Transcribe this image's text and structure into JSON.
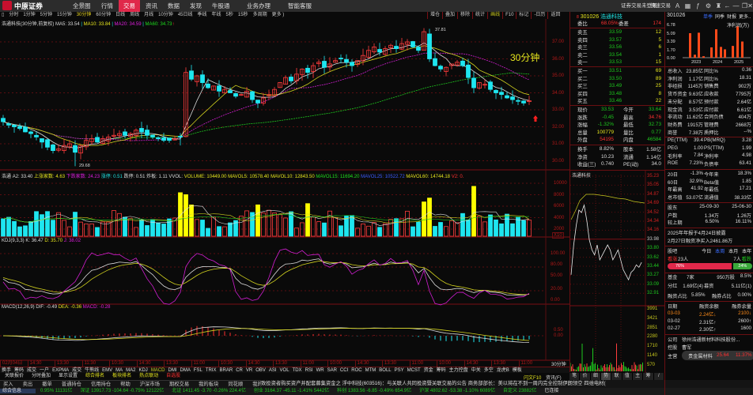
{
  "app": {
    "logo": "中原证券",
    "nav": [
      "全景图",
      "行情",
      "交易",
      "资讯",
      "数据",
      "发现",
      "牛股通",
      "业务办理",
      "智能客服"
    ],
    "active_nav": "交易",
    "login": "证券交易未登录",
    "quick_trade": "快速交易"
  },
  "periods": [
    "▯",
    "分时",
    "1分钟",
    "5分钟",
    "15分钟",
    "30分钟",
    "60分钟",
    "日线",
    "周线",
    "月线",
    "10分钟",
    "45日线",
    "季线",
    "年线",
    "5秒",
    "15秒",
    "多周期",
    "更多 )"
  ],
  "active_period": "30分钟",
  "toolbar2": [
    "增仓",
    "叠加",
    "移除",
    "统计",
    "画线",
    "F10",
    "标记",
    "-日历",
    "返回"
  ],
  "main": {
    "title": "浩通科技(30分钟,前复权)",
    "ma5": "MA5: 33.54",
    "ma10": "MA10: 33.84",
    "ma20": "MA20: 34.59",
    "ma60": "MA60: 34.73",
    "period_label": "30分钟",
    "high_label": "37.81",
    "low_label": "29.68",
    "price_axis": [
      "37.00",
      "36.00",
      "35.00",
      "34.00",
      "33.00",
      "32.00",
      "31.00",
      "30.00"
    ]
  },
  "chart_data": {
    "type": "candlestick",
    "closes": [
      32.3,
      32.1,
      32.0,
      31.9,
      31.7,
      31.6,
      31.4,
      31.1,
      30.8,
      30.6,
      30.7,
      30.9,
      31.0,
      30.5,
      30.9,
      31.2,
      31.3,
      31.1,
      31.3,
      31.4,
      31.5,
      31.6,
      31.5,
      31.6,
      31.8,
      31.7,
      31.5,
      31.4,
      31.3,
      31.2,
      31.2,
      31.3,
      31.4,
      35.2,
      34.8,
      35.0,
      34.6,
      34.3,
      34.4,
      34.1,
      34.2,
      34.0,
      33.8,
      33.9,
      34.1,
      33.6,
      33.4,
      33.7,
      33.9,
      34.2,
      34.6,
      34.9,
      34.7,
      35.1,
      35.4,
      35.2,
      35.6,
      35.8,
      35.5,
      35.7,
      35.9,
      36.0,
      35.8,
      35.6,
      35.9,
      36.2,
      36.5,
      36.7,
      36.4,
      36.6,
      36.8,
      36.6,
      36.9,
      37.0,
      36.7,
      36.5,
      37.6,
      36.0,
      35.6,
      35.4,
      35.5,
      35.7,
      35.8,
      35.6,
      34.9,
      34.3,
      34.6,
      34.5,
      34.2,
      34.0,
      33.9,
      33.7,
      33.6,
      33.5,
      33.4,
      33.53
    ],
    "ylim": [
      29.5,
      38
    ]
  },
  "vol": {
    "title": "浩通",
    "a2": "A2: 33.40",
    "l1": "上涨家数: 4.63",
    "l2": "下跌家数: 24.23",
    "l3": "涨停: 0.51",
    "l4": "跌停: 0.51",
    "l5": "炸板: 1.11",
    "vvol": "VVOL:",
    "volume": "VOLUME: 10449.00",
    "mavol5": "MAVOL5: 10578.40",
    "mavol10": "MAVOL10: 12843.50",
    "mavol15": "MAVOL15: 11694.20",
    "mavol25": "MAVOL25: 10522.72",
    "mavol60": "MAVOL60: 14744.18",
    "v2": "V2: 0.",
    "axis": [
      "10000",
      "8000",
      "6000",
      "4000",
      "2000"
    ],
    "unit": "X10"
  },
  "kdj": {
    "title": "KDJ(9,3,3)",
    "k": "K: 36.47",
    "d": "D: 35.70",
    "j": "J: 38.02",
    "axis": [
      "100.00",
      "80.00",
      "50.00",
      "20.00",
      "0.00"
    ]
  },
  "macd": {
    "title": "MACD(12,26,9)",
    "dif": "DIF: -0.49",
    "dea": "DEA: -0.36",
    "macd": "MACD: -0.28",
    "axis": [
      "0.50",
      "0.00"
    ]
  },
  "time_axis": [
    "02月04日",
    "14:30",
    "13:30",
    "11:30",
    "10:30",
    "14:30",
    "13:30",
    "11:00",
    "10:30",
    "14:30",
    "13:30",
    "11:00",
    "10:00",
    "14:30",
    "13:30",
    "11:00",
    "10:00",
    "14:30",
    "13:30",
    "11:00"
  ],
  "corner_label": "30分钟",
  "indicator_tabs": [
    "换手",
    "筹码",
    "成交",
    "一户",
    "EXPMA",
    "成交",
    "牛熊线",
    "EMV",
    "MA",
    "MA2",
    "KDJ",
    "MACD",
    "DMI",
    "DMA",
    "FSL",
    "TRIX",
    "BRAR",
    "CR",
    "VR",
    "OBV",
    "ASI",
    "VOL",
    "TDX",
    "RSI",
    "WR",
    "SAR",
    "CCI",
    "ROC",
    "MTM",
    "BOLL",
    "PSY",
    "MCST",
    "资金",
    "筹码",
    "主力控盘",
    "中关",
    "多空",
    "龙虎B",
    "模板"
  ],
  "active_indicator": "MACD",
  "bottom_links": [
    {
      "t": "关联报价",
      "c": "#dddddd"
    },
    {
      "t": "分时叠加",
      "c": "#dddddd"
    },
    {
      "t": "显示设置",
      "c": "#dddddd"
    },
    {
      "t": "综合排名",
      "c": "#e6e61e"
    },
    {
      "t": "板块排名",
      "c": "#e6e61e"
    },
    {
      "t": "热点联动",
      "c": "#e6e61e"
    },
    {
      "t": "自选股",
      "c": "#ff3030"
    }
  ],
  "actions": [
    "买入",
    "卖出",
    "撤单",
    "普通持仓",
    "信用持仓",
    "帮助",
    "沪深市场",
    "期权交易",
    "我的板块",
    "同花顺",
    "我的自选",
    "自选股资讯",
    "+"
  ],
  "f10": "闪文F10",
  "news_tab": "资讯(F)",
  "news": "致投资者购买资产并配套募集资金之    浮中科技(603516)：与关联人共同投资暨关联交易的公告    商务部部长：美以将在不到一周内完全控制伊朗领空    四维电材(",
  "status": {
    "label": "综合信息",
    "items": [
      "0.95%  11131亿",
      "深证 13917.73  -104.64  -0.75%  12122亿",
      "北证 1411.45  -3.70  -0.26%  224.4亿",
      "创业 3164.37  -45.11  -1.41%  5442亿",
      "科创 1383.56  -6.85  -0.49%  654.9亿",
      "沪深 4802.62  -53.38  -1.10%  6089亿",
      "自定义  23882亿",
      "已连接"
    ]
  },
  "quote": {
    "code": "301026",
    "name": "浩通科技",
    "wb_label": "委比",
    "wb": "68.05%",
    "wc_label": "委差",
    "wc": "174",
    "sells": [
      {
        "l": "卖五",
        "p": "33.59",
        "v": "12"
      },
      {
        "l": "卖四",
        "p": "33.57",
        "v": "5"
      },
      {
        "l": "卖三",
        "p": "33.56",
        "v": "6"
      },
      {
        "l": "卖二",
        "p": "33.54",
        "v": "1"
      },
      {
        "l": "卖一",
        "p": "33.53",
        "v": "15"
      }
    ],
    "buys": [
      {
        "l": "买一",
        "p": "33.51",
        "v": "69"
      },
      {
        "l": "买二",
        "p": "33.50",
        "v": "89"
      },
      {
        "l": "买三",
        "p": "33.49",
        "v": "25"
      },
      {
        "l": "买四",
        "p": "33.48",
        "v": "8"
      },
      {
        "l": "买五",
        "p": "33.46",
        "v": "22"
      }
    ],
    "stats": [
      [
        "现价",
        "33.53",
        "今开",
        "33.64"
      ],
      [
        "涨跌",
        "-0.45",
        "最高",
        "34.76"
      ],
      [
        "涨幅",
        "-1.32%",
        "最低",
        "32.73"
      ],
      [
        "总量",
        "100779",
        "量比",
        "0.77"
      ],
      [
        "外盘",
        "54195",
        "内盘",
        "46584"
      ]
    ],
    "stats2": [
      [
        "换手",
        "8.82%",
        "股本",
        "1.58亿"
      ],
      [
        "净资",
        "10.23",
        "流通",
        "1.14亿"
      ],
      [
        "收益(三)",
        "0.740",
        "PE(动)",
        "34.0"
      ]
    ]
  },
  "mini": {
    "title": "浩通科技",
    "price_axis": [
      "35.23",
      "35.05",
      "34.87",
      "34.69",
      "34.52",
      "34.34",
      "34.16",
      "33.98",
      "33.80",
      "33.62",
      "33.44",
      "33.27",
      "33.09",
      "32.91"
    ],
    "vol_axis": [
      "3991",
      "3421",
      "2851",
      "2280",
      "1710",
      "1140",
      "570"
    ],
    "tabs": [
      "笔",
      "价",
      "细",
      "势",
      "联",
      "值",
      "主",
      "筹",
      "/"
    ]
  },
  "fin": {
    "code": "301026",
    "tabs": [
      "单季",
      "同季",
      "财报",
      "更多.."
    ],
    "chart_title": "净利润(万)",
    "chart_axis": [
      "6.78",
      "5.09",
      "3.39",
      "1.70",
      "0.00"
    ],
    "years": [
      "2023",
      "2024",
      "2025"
    ],
    "bars": [
      5.0,
      0.6,
      5.1,
      0.3,
      2.1,
      5.8,
      2.2,
      1.7,
      2.4,
      6.4,
      3.3
    ],
    "rows": [
      [
        "总收入",
        "23.85亿",
        "同比%",
        "0.36"
      ],
      [
        "净利润",
        "1.17亿",
        "同比%",
        "18.31"
      ],
      [
        "非经损",
        "1145万",
        "销售费",
        "902万"
      ],
      [
        "货币资金",
        "9.63亿",
        "应收款",
        "7795万"
      ],
      [
        "未分配",
        "8.57亿",
        "预付款",
        "2.64亿"
      ],
      [
        "现金流",
        "3.53亿",
        "应付款",
        "6.61亿"
      ],
      [
        "非流动",
        "11.62亿",
        "合同负债",
        "404万"
      ],
      [
        "财务费",
        "1915万",
        "管理费",
        "2668万"
      ],
      [
        "商誉",
        "7.38万",
        "质押比",
        "--%"
      ]
    ],
    "val": [
      [
        "PE(TTM)",
        "39.4",
        "PB(MRQ)",
        "3.28"
      ],
      [
        "PEG",
        "1.00",
        "PS(TTM)",
        "1.99"
      ],
      [
        "毛利率",
        "7.84",
        "净利率",
        "4.98"
      ],
      [
        "ROE",
        "7.23%",
        "负债率",
        "63.41"
      ]
    ],
    "perf": [
      [
        "20日",
        "-1.3%",
        "今年来",
        "18.3%"
      ],
      [
        "60日",
        "32.9%",
        "Beta值",
        "1.85"
      ],
      [
        "年最高",
        "41.92",
        "年最低",
        "17.21"
      ],
      [
        "总市值",
        "53.07亿",
        "流通值",
        "38.33亿"
      ]
    ],
    "holders": [
      [
        "股东",
        "25-09-30",
        "25-06-30"
      ],
      [
        "户数",
        "1.34万",
        "1.26万"
      ],
      [
        "较上期",
        "6.50%",
        "16.11%"
      ]
    ],
    "notice1": "2025年年报于4月24日披露",
    "notice2": "2月27日融资净买入2461.86万",
    "guba": {
      "label": "股吧",
      "tabs": [
        "今日",
        "本周",
        "本月",
        "本年"
      ],
      "bull": "看涨",
      "bull_n": "23人",
      "bear_n": "7人",
      "bear": "看跌",
      "bull_pct": "76%",
      "bear_pct": "24%",
      "bull_frac": 0.76
    },
    "fund": [
      "基金",
      "7家",
      "950万股",
      "8.5%"
    ],
    "div": [
      "分红",
      "1.69亿(4)",
      "募资",
      "5.11亿(1)"
    ],
    "margin": [
      "融资占比",
      "5.85%",
      "融券占比",
      "0.00%"
    ],
    "mhead": [
      "日期",
      "融资余额",
      "融券余量"
    ],
    "mrows": [
      [
        "03-03",
        "2.24亿↓",
        "2100↓"
      ],
      [
        "03-02",
        "2.31亿↑",
        "2600↑"
      ],
      [
        "02-27",
        "2.30亿↑",
        "1600"
      ]
    ],
    "company": [
      "公司",
      "徐州浩通新材料科技股份..."
    ],
    "holder": [
      "控股",
      "曹军"
    ],
    "main_biz": [
      "主营",
      "贵金属材料",
      "25.64",
      "11.37%"
    ]
  }
}
